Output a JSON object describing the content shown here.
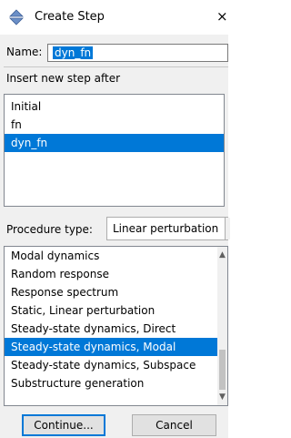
{
  "window": {
    "title": "Create Step",
    "icon": "create-step-icon",
    "close_glyph": "×"
  },
  "name": {
    "label": "Name:",
    "value": "dyn_fn"
  },
  "insert_after": {
    "label": "Insert new step after",
    "items": [
      "Initial",
      "fn",
      "dyn_fn"
    ],
    "selected": "dyn_fn"
  },
  "procedure": {
    "label": "Procedure type:",
    "value": "Linear perturbation",
    "items": [
      "Modal dynamics",
      "Random response",
      "Response spectrum",
      "Static, Linear perturbation",
      "Steady-state dynamics, Direct",
      "Steady-state dynamics, Modal",
      "Steady-state dynamics, Subspace",
      "Substructure generation"
    ],
    "selected": "Steady-state dynamics, Modal"
  },
  "buttons": {
    "continue": "Continue...",
    "cancel": "Cancel"
  },
  "colors": {
    "selection": "#0078d7",
    "dialog_bg": "#f0f0f0"
  }
}
